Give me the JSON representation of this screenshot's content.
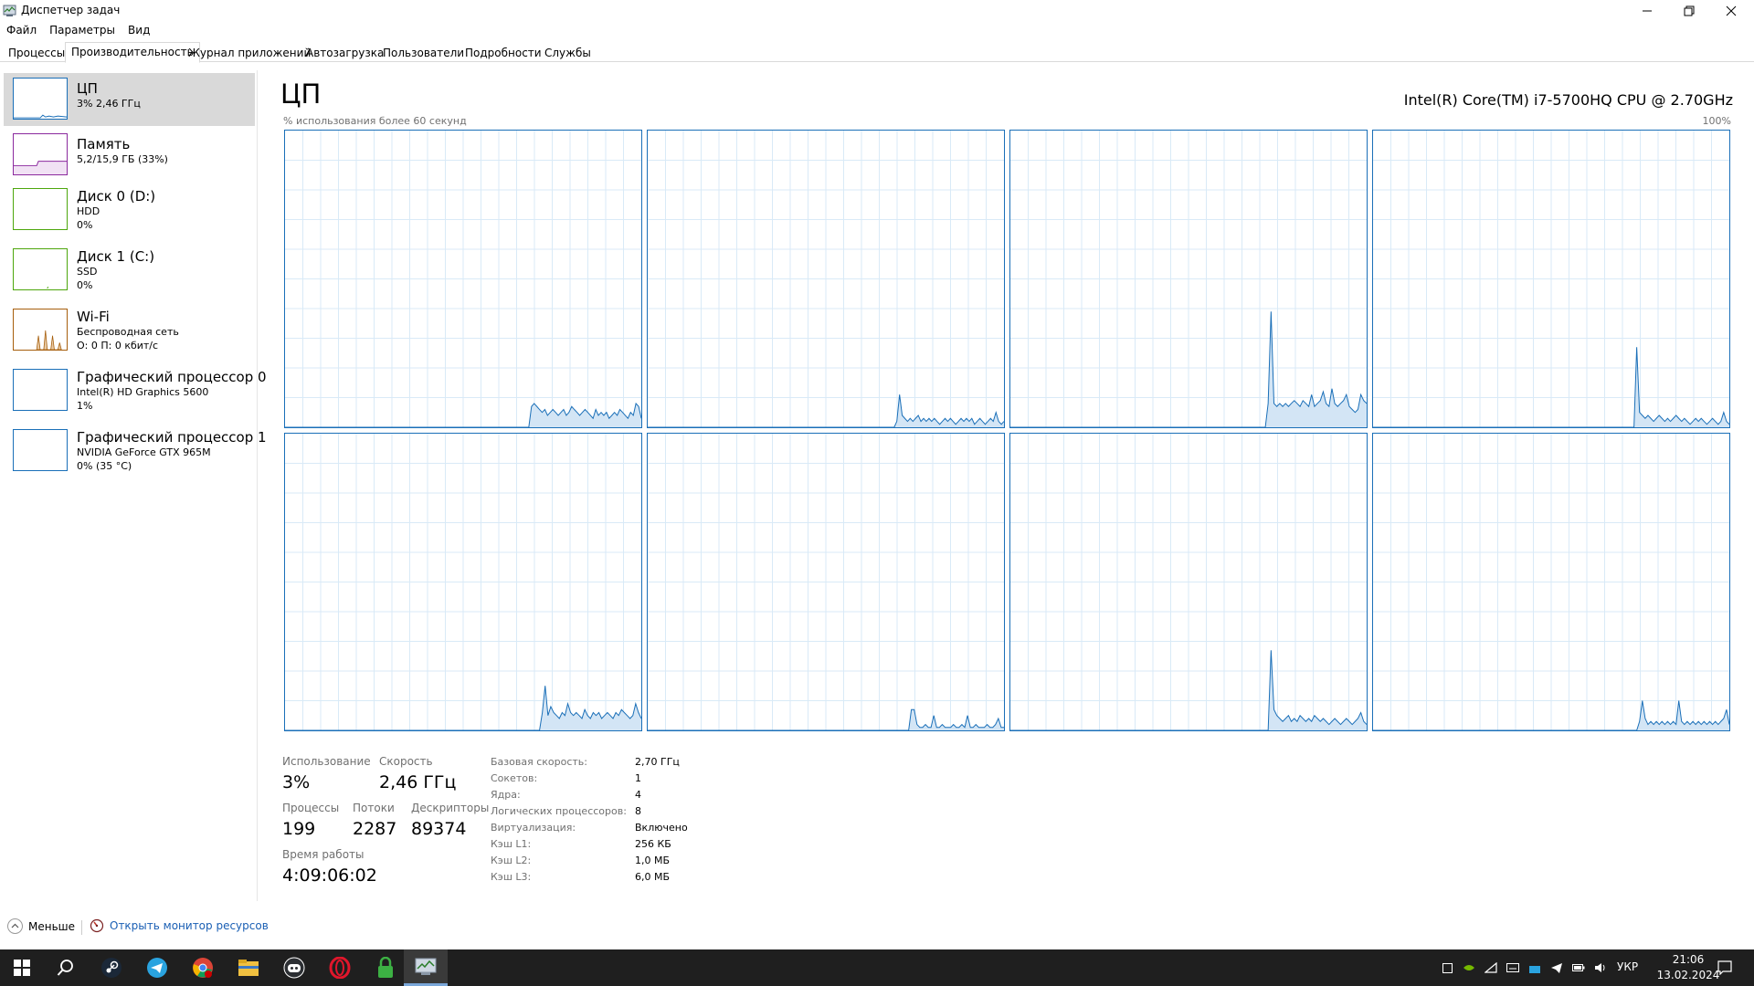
{
  "window": {
    "title": "Диспетчер задач"
  },
  "menu": [
    "Файл",
    "Параметры",
    "Вид"
  ],
  "tabs": [
    {
      "label": "Процессы",
      "active": false
    },
    {
      "label": "Производительность",
      "active": true
    },
    {
      "label": "Журнал приложений",
      "active": false
    },
    {
      "label": "Автозагрузка",
      "active": false
    },
    {
      "label": "Пользователи",
      "active": false
    },
    {
      "label": "Подробности",
      "active": false
    },
    {
      "label": "Службы",
      "active": false
    }
  ],
  "sidebar": {
    "items": [
      {
        "name": "ЦП",
        "sub1": "3% 2,46 ГГц",
        "sub2": "",
        "color": "#1a6fb8",
        "selected": true
      },
      {
        "name": "Память",
        "sub1": "5,2/15,9 ГБ (33%)",
        "sub2": "",
        "color": "#8b2a9e",
        "selected": false
      },
      {
        "name": "Диск 0 (D:)",
        "sub1": "HDD",
        "sub2": "0%",
        "color": "#4da60c",
        "selected": false
      },
      {
        "name": "Диск 1 (C:)",
        "sub1": "SSD",
        "sub2": "0%",
        "color": "#4da60c",
        "selected": false
      },
      {
        "name": "Wi-Fi",
        "sub1": "Беспроводная сеть",
        "sub2": "О: 0 П: 0 кбит/с",
        "color": "#a65e0c",
        "selected": false
      },
      {
        "name": "Графический процессор 0",
        "sub1": "Intel(R) HD Graphics 5600",
        "sub2": "1%",
        "color": "#1a6fb8",
        "selected": false
      },
      {
        "name": "Графический процессор 1",
        "sub1": "NVIDIA GeForce GTX 965M",
        "sub2": "0% (35 °C)",
        "color": "#1a6fb8",
        "selected": false
      }
    ]
  },
  "main": {
    "title": "ЦП",
    "cpu_model": "Intel(R) Core(TM) i7-5700HQ CPU @ 2.70GHz",
    "graph_caption": "% использования более 60 секунд",
    "graph_max": "100%"
  },
  "cores": [
    [
      0,
      0,
      0,
      0,
      0,
      0,
      0,
      0,
      0,
      0,
      0,
      0,
      0,
      0,
      0,
      0,
      0,
      0,
      0,
      0,
      0,
      0,
      0,
      0,
      0,
      0,
      0,
      0,
      0,
      0,
      0,
      0,
      0,
      0,
      0,
      0,
      0,
      0,
      0,
      0,
      0,
      0,
      0,
      0,
      0,
      0,
      0,
      0,
      0,
      0,
      0,
      0,
      0,
      0,
      0,
      0,
      0,
      0,
      0,
      0,
      0,
      0,
      0,
      0,
      0,
      0,
      0,
      0,
      0,
      0,
      0,
      0,
      0,
      0,
      0,
      0,
      0,
      0,
      0,
      0,
      0,
      0,
      0,
      0,
      0,
      0,
      0,
      0,
      0,
      0,
      0,
      0,
      7,
      8,
      7,
      6,
      5,
      6,
      4,
      5,
      6,
      5,
      4,
      5,
      6,
      4,
      5,
      7,
      6,
      5,
      4,
      5,
      6,
      5,
      4,
      3,
      6,
      4,
      5,
      4,
      5,
      3,
      4,
      5,
      4,
      6,
      5,
      4,
      3,
      5,
      4,
      8,
      7,
      3
    ],
    [
      0,
      0,
      0,
      0,
      0,
      0,
      0,
      0,
      0,
      0,
      0,
      0,
      0,
      0,
      0,
      0,
      0,
      0,
      0,
      0,
      0,
      0,
      0,
      0,
      0,
      0,
      0,
      0,
      0,
      0,
      0,
      0,
      0,
      0,
      0,
      0,
      0,
      0,
      0,
      0,
      0,
      0,
      0,
      0,
      0,
      0,
      0,
      0,
      0,
      0,
      0,
      0,
      0,
      0,
      0,
      0,
      0,
      0,
      0,
      0,
      0,
      0,
      0,
      0,
      0,
      0,
      0,
      0,
      0,
      0,
      0,
      0,
      0,
      0,
      0,
      0,
      0,
      0,
      0,
      0,
      0,
      0,
      0,
      0,
      0,
      0,
      0,
      0,
      0,
      0,
      0,
      0,
      0,
      2,
      11,
      4,
      3,
      2,
      3,
      2,
      3,
      4,
      2,
      3,
      2,
      3,
      2,
      3,
      2,
      1,
      2,
      3,
      2,
      3,
      2,
      1,
      2,
      3,
      2,
      3,
      2,
      3,
      1,
      2,
      3,
      2,
      1,
      2,
      3,
      2,
      5,
      2,
      1,
      2
    ],
    [
      0,
      0,
      0,
      0,
      0,
      0,
      0,
      0,
      0,
      0,
      0,
      0,
      0,
      0,
      0,
      0,
      0,
      0,
      0,
      0,
      0,
      0,
      0,
      0,
      0,
      0,
      0,
      0,
      0,
      0,
      0,
      0,
      0,
      0,
      0,
      0,
      0,
      0,
      0,
      0,
      0,
      0,
      0,
      0,
      0,
      0,
      0,
      0,
      0,
      0,
      0,
      0,
      0,
      0,
      0,
      0,
      0,
      0,
      0,
      0,
      0,
      0,
      0,
      0,
      0,
      0,
      0,
      0,
      0,
      0,
      0,
      0,
      0,
      0,
      0,
      0,
      0,
      0,
      0,
      0,
      0,
      0,
      0,
      0,
      0,
      0,
      0,
      0,
      0,
      8,
      39,
      8,
      7,
      8,
      7,
      8,
      7,
      8,
      9,
      8,
      7,
      9,
      8,
      7,
      11,
      7,
      8,
      9,
      12,
      8,
      7,
      13,
      8,
      7,
      8,
      9,
      11,
      7,
      6,
      5,
      6,
      11,
      9,
      8
    ],
    [
      0,
      0,
      0,
      0,
      0,
      0,
      0,
      0,
      0,
      0,
      0,
      0,
      0,
      0,
      0,
      0,
      0,
      0,
      0,
      0,
      0,
      0,
      0,
      0,
      0,
      0,
      0,
      0,
      0,
      0,
      0,
      0,
      0,
      0,
      0,
      0,
      0,
      0,
      0,
      0,
      0,
      0,
      0,
      0,
      0,
      0,
      0,
      0,
      0,
      0,
      0,
      0,
      0,
      0,
      0,
      0,
      0,
      0,
      0,
      0,
      0,
      0,
      0,
      0,
      0,
      0,
      0,
      0,
      0,
      0,
      0,
      0,
      0,
      0,
      0,
      0,
      0,
      0,
      0,
      0,
      0,
      0,
      0,
      0,
      0,
      0,
      0,
      0,
      0,
      0,
      0,
      0,
      0,
      0,
      27,
      5,
      4,
      3,
      4,
      3,
      2,
      3,
      4,
      3,
      2,
      3,
      2,
      3,
      4,
      3,
      2,
      3,
      2,
      1,
      2,
      3,
      2,
      3,
      2,
      1,
      2,
      3,
      2,
      1,
      2,
      5,
      2,
      1
    ],
    [
      0,
      0,
      0,
      0,
      0,
      0,
      0,
      0,
      0,
      0,
      0,
      0,
      0,
      0,
      0,
      0,
      0,
      0,
      0,
      0,
      0,
      0,
      0,
      0,
      0,
      0,
      0,
      0,
      0,
      0,
      0,
      0,
      0,
      0,
      0,
      0,
      0,
      0,
      0,
      0,
      0,
      0,
      0,
      0,
      0,
      0,
      0,
      0,
      0,
      0,
      0,
      0,
      0,
      0,
      0,
      0,
      0,
      0,
      0,
      0,
      0,
      0,
      0,
      0,
      0,
      0,
      0,
      0,
      0,
      0,
      0,
      0,
      0,
      0,
      0,
      0,
      0,
      0,
      0,
      0,
      0,
      0,
      0,
      0,
      0,
      0,
      0,
      0,
      0,
      0,
      0,
      6,
      15,
      5,
      8,
      6,
      5,
      4,
      6,
      5,
      9,
      6,
      5,
      6,
      5,
      4,
      7,
      5,
      4,
      6,
      5,
      6,
      4,
      5,
      6,
      5,
      4,
      6,
      5,
      7,
      6,
      5,
      4,
      5,
      9,
      6,
      4
    ],
    [
      0,
      0,
      0,
      0,
      0,
      0,
      0,
      0,
      0,
      0,
      0,
      0,
      0,
      0,
      0,
      0,
      0,
      0,
      0,
      0,
      0,
      0,
      0,
      0,
      0,
      0,
      0,
      0,
      0,
      0,
      0,
      0,
      0,
      0,
      0,
      0,
      0,
      0,
      0,
      0,
      0,
      0,
      0,
      0,
      0,
      0,
      0,
      0,
      0,
      0,
      0,
      0,
      0,
      0,
      0,
      0,
      0,
      0,
      0,
      0,
      0,
      0,
      0,
      0,
      0,
      0,
      0,
      0,
      0,
      0,
      0,
      0,
      0,
      0,
      0,
      0,
      0,
      0,
      0,
      0,
      0,
      0,
      0,
      0,
      0,
      0,
      0,
      0,
      0,
      0,
      0,
      0,
      0,
      0,
      7,
      7,
      2,
      1,
      1,
      2,
      1,
      1,
      5,
      1,
      1,
      2,
      1,
      1,
      1,
      2,
      1,
      1,
      2,
      1,
      5,
      1,
      1,
      2,
      1,
      1,
      1,
      2,
      1,
      1,
      2,
      4,
      1,
      1
    ],
    [
      0,
      0,
      0,
      0,
      0,
      0,
      0,
      0,
      0,
      0,
      0,
      0,
      0,
      0,
      0,
      0,
      0,
      0,
      0,
      0,
      0,
      0,
      0,
      0,
      0,
      0,
      0,
      0,
      0,
      0,
      0,
      0,
      0,
      0,
      0,
      0,
      0,
      0,
      0,
      0,
      0,
      0,
      0,
      0,
      0,
      0,
      0,
      0,
      0,
      0,
      0,
      0,
      0,
      0,
      0,
      0,
      0,
      0,
      0,
      0,
      0,
      0,
      0,
      0,
      0,
      0,
      0,
      0,
      0,
      0,
      0,
      0,
      0,
      0,
      0,
      0,
      0,
      0,
      0,
      0,
      0,
      0,
      0,
      0,
      0,
      0,
      0,
      0,
      0,
      0,
      27,
      7,
      5,
      4,
      3,
      4,
      5,
      3,
      4,
      3,
      5,
      4,
      3,
      4,
      3,
      5,
      4,
      3,
      4,
      3,
      2,
      3,
      4,
      3,
      2,
      3,
      4,
      3,
      2,
      3,
      4,
      6,
      3,
      2
    ],
    [
      0,
      0,
      0,
      0,
      0,
      0,
      0,
      0,
      0,
      0,
      0,
      0,
      0,
      0,
      0,
      0,
      0,
      0,
      0,
      0,
      0,
      0,
      0,
      0,
      0,
      0,
      0,
      0,
      0,
      0,
      0,
      0,
      0,
      0,
      0,
      0,
      0,
      0,
      0,
      0,
      0,
      0,
      0,
      0,
      0,
      0,
      0,
      0,
      0,
      0,
      0,
      0,
      0,
      0,
      0,
      0,
      0,
      0,
      0,
      0,
      0,
      0,
      0,
      0,
      0,
      0,
      0,
      0,
      0,
      0,
      0,
      0,
      0,
      0,
      0,
      0,
      0,
      0,
      0,
      0,
      0,
      0,
      0,
      0,
      0,
      0,
      0,
      0,
      0,
      0,
      0,
      0,
      0,
      0,
      0,
      3,
      10,
      4,
      2,
      3,
      2,
      3,
      2,
      3,
      2,
      3,
      2,
      3,
      2,
      10,
      3,
      2,
      3,
      2,
      3,
      2,
      3,
      2,
      3,
      2,
      3,
      2,
      3,
      2,
      3,
      4,
      7,
      2
    ]
  ],
  "stats": {
    "usage_label": "Использование",
    "usage_value": "3%",
    "speed_label": "Скорость",
    "speed_value": "2,46 ГГц",
    "processes_label": "Процессы",
    "processes_value": "199",
    "threads_label": "Потоки",
    "threads_value": "2287",
    "handles_label": "Дескрипторы",
    "handles_value": "89374",
    "uptime_label": "Время работы",
    "uptime_value": "4:09:06:02"
  },
  "info": [
    {
      "label": "Базовая скорость:",
      "value": "2,70 ГГц"
    },
    {
      "label": "Сокетов:",
      "value": "1"
    },
    {
      "label": "Ядра:",
      "value": "4"
    },
    {
      "label": "Логических процессоров:",
      "value": "8"
    },
    {
      "label": "Виртуализация:",
      "value": "Включено"
    },
    {
      "label": "Кэш L1:",
      "value": "256 КБ"
    },
    {
      "label": "Кэш L2:",
      "value": "1,0 МБ"
    },
    {
      "label": "Кэш L3:",
      "value": "6,0 МБ"
    }
  ],
  "bottom": {
    "fewer_label": "Меньше",
    "monitor_label": "Открыть монитор ресурсов"
  },
  "taskbar": {
    "apps": [
      "windows-start-icon",
      "search-icon",
      "steam-icon",
      "telegram-icon",
      "chrome-icon",
      "file-explorer-icon",
      "discord-icon",
      "opera-icon",
      "vpn-lock-icon",
      "task-manager-icon"
    ],
    "language": "УКР",
    "time": "21:06",
    "date": "13.02.2024"
  },
  "colors": {
    "cpu_accent": "#1a6fb8",
    "cpu_fill": "#d3e5f5",
    "grid": "#d9eaf7"
  }
}
